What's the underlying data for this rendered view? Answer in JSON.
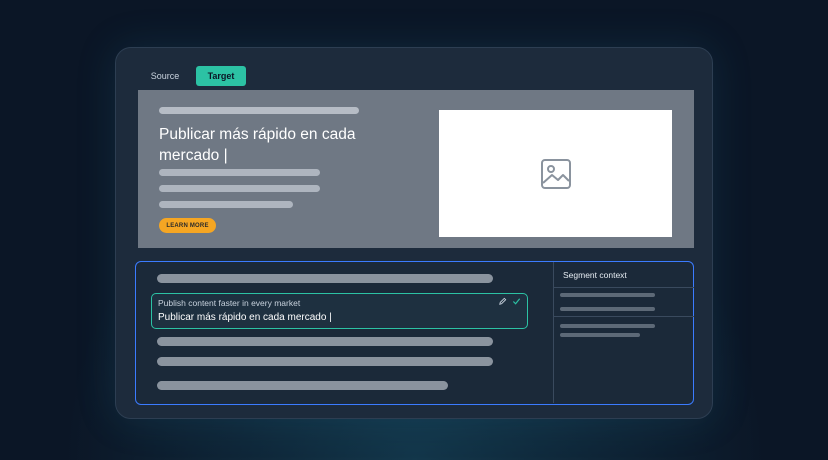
{
  "tabs": {
    "source_label": "Source",
    "target_label": "Target"
  },
  "preview": {
    "headline": "Publicar más rápido en cada mercado |",
    "cta_label": "LEARN MORE"
  },
  "editor": {
    "active_segment": {
      "source_text": "Publish content faster in every market",
      "target_text": "Publicar más rápido en cada mercado |"
    },
    "side_panel_title": "Segment context"
  },
  "colors": {
    "accent": "#2cc2a4",
    "cta": "#f5a623",
    "editor_border": "#3b7bff",
    "background": "#0b1626"
  }
}
